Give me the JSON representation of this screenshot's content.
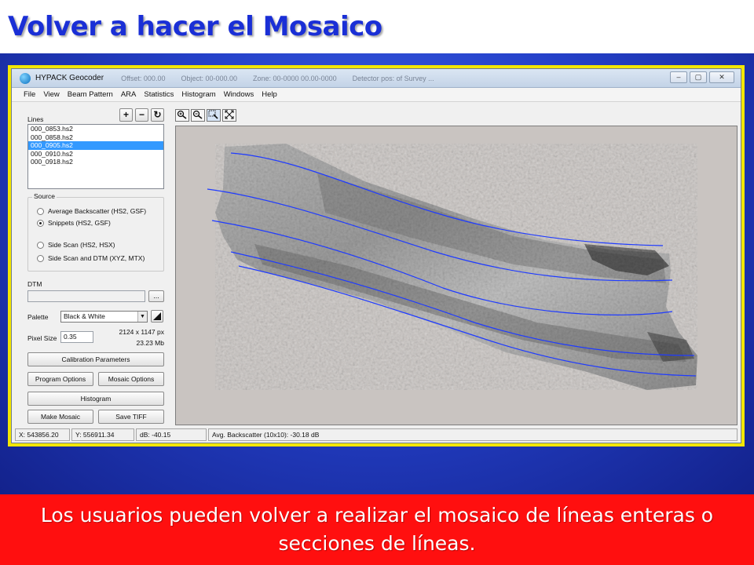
{
  "slide": {
    "title": "Volver a hacer el Mosaico",
    "caption": "Los usuarios pueden volver a realizar el mosaico de líneas enteras o secciones de líneas."
  },
  "window": {
    "title": "HYPACK Geocoder",
    "title_extra": [
      "Offset: 000.00",
      "Object: 00-000.00",
      "Zone: 00-0000 00.00-0000",
      "Detector pos: of Survey ..."
    ],
    "controls": [
      "–",
      "▢",
      "✕"
    ]
  },
  "menu": [
    "File",
    "View",
    "Beam Pattern",
    "ARA",
    "Statistics",
    "Histogram",
    "Windows",
    "Help"
  ],
  "lines_panel": {
    "label": "Lines",
    "tool_buttons": [
      "+",
      "−",
      "↻"
    ],
    "items": [
      "000_0853.hs2",
      "000_0858.hs2",
      "000_0905.hs2",
      "000_0910.hs2",
      "000_0918.hs2"
    ],
    "selected_index": 2
  },
  "source": {
    "label": "Source",
    "options": [
      "Average Backscatter (HS2, GSF)",
      "Snippets (HS2, GSF)",
      "Side Scan (HS2, HSX)",
      "Side Scan and DTM (XYZ, MTX)"
    ],
    "selected_index": 1
  },
  "dtm": {
    "label": "DTM",
    "value": "",
    "browse": "..."
  },
  "palette": {
    "label": "Palette",
    "value": "Black & White",
    "icon": "palette-edit-icon"
  },
  "pixel_size": {
    "label": "Pixel Size",
    "value": "0.35",
    "dims": "2124 x 1147 px",
    "size": "23.23 Mb"
  },
  "buttons": {
    "calibration": "Calibration Parameters",
    "program_options": "Program Options",
    "mosaic_options": "Mosaic Options",
    "histogram": "Histogram",
    "make_mosaic": "Make Mosaic",
    "save_tiff": "Save TIFF"
  },
  "mosaic_toolbar": [
    "zoom-in-icon",
    "zoom-out-icon",
    "zoom-window-icon",
    "zoom-extents-icon"
  ],
  "status": {
    "x": "X: 543856.20",
    "y": "Y: 556911.34",
    "db": "dB: -40.15",
    "avg": "Avg. Backscatter (10x10): -30.18 dB"
  },
  "colors": {
    "title": "#1a2fd6",
    "frame": "#f3e600",
    "caption_band": "#ff0f0f",
    "track_lines": "#1f3bff",
    "selection": "#3399ff"
  }
}
